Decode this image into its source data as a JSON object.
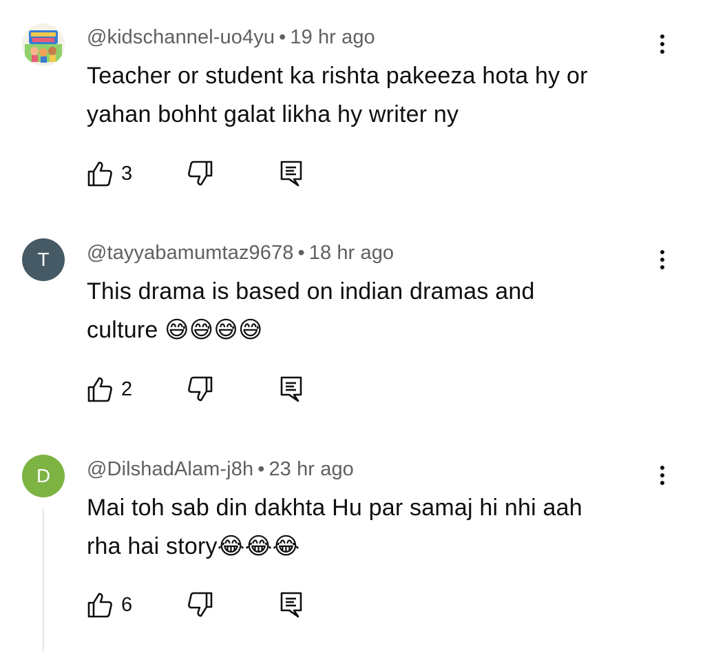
{
  "comments": [
    {
      "handle": "@kidschannel-uo4yu",
      "separator": "•",
      "time": "19 hr ago",
      "text_lines": [
        "Teacher or student ka rishta pakeeza hota hy or",
        "yahan bohht galat likha hy writer ny"
      ],
      "likes": "3",
      "avatar_letter": "",
      "avatar_type": "image",
      "avatar_color": "#f2c94c"
    },
    {
      "handle": "@tayyabamumtaz9678",
      "separator": "•",
      "time": "18 hr ago",
      "text_lines": [
        "This drama is based on indian dramas and",
        "culture 😅😅😅😅"
      ],
      "likes": "2",
      "avatar_letter": "T",
      "avatar_type": "letter",
      "avatar_color": "#455a64"
    },
    {
      "handle": "@DilshadAlam-j8h",
      "separator": "•",
      "time": "23 hr ago",
      "text_lines": [
        "Mai toh sab din dakhta Hu par samaj hi nhi aah",
        "rha hai story😂😂😂"
      ],
      "likes": "6",
      "avatar_letter": "D",
      "avatar_type": "letter",
      "avatar_color": "#7cb342"
    }
  ],
  "icons": {
    "like": "thumb-up-icon",
    "dislike": "thumb-down-icon",
    "reply": "reply-comment-icon",
    "more": "more-vert-icon"
  }
}
